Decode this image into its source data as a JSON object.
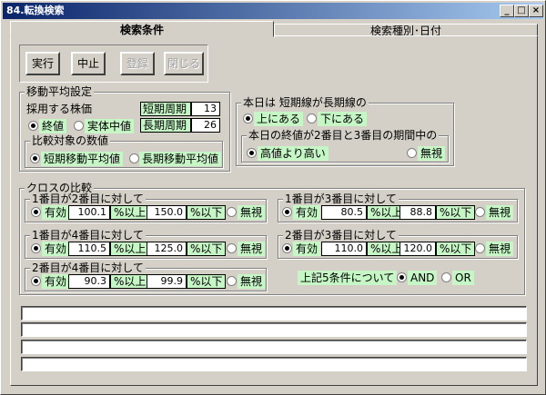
{
  "window": {
    "title": "84.転換検索",
    "min": "_",
    "max": "□",
    "close": "×"
  },
  "tabs": [
    {
      "label": "検索条件"
    },
    {
      "label": "検索種別･日付"
    }
  ],
  "toolbar": {
    "run": "実行",
    "stop": "中止",
    "register": "登録",
    "close": "閉じる"
  },
  "ma": {
    "title": "移動平均設定",
    "price_label": "採用する株価",
    "price_close": "終値",
    "price_body": "実体中値",
    "short_label": "短期周期",
    "short_value": "13",
    "long_label": "長期周期",
    "long_value": "26",
    "cmp_title": "比較対象の数値",
    "cmp_short": "短期移動平均値",
    "cmp_long": "長期移動平均値"
  },
  "today": {
    "title": "本日は 短期線が長期線の",
    "above": "上にある",
    "below": "下にある",
    "sub_title": "本日の終値が2番目と3番目の期間中の",
    "higher": "高値より高い",
    "ignore": "無視"
  },
  "cross": {
    "title": "クロスの比較",
    "valid": "有効",
    "ignore": "無視",
    "ge": "%以上",
    "le": "%以下",
    "g12": {
      "title": "1番目が2番目に対して",
      "low": "100.1",
      "high": "150.0"
    },
    "g13": {
      "title": "1番目が3番目に対して",
      "low": "80.5",
      "high": "88.8"
    },
    "g14": {
      "title": "1番目が4番目に対して",
      "low": "110.5",
      "high": "125.0"
    },
    "g23": {
      "title": "2番目が3番目に対して",
      "low": "110.0",
      "high": "120.0"
    },
    "g24": {
      "title": "2番目が4番目に対して",
      "low": "90.3",
      "high": "99.9"
    },
    "logic_label": "上記5条件について",
    "and": "AND",
    "or": "OR"
  },
  "colors": {
    "highlight": "#c6f6c6",
    "title_bar": "#0a246a",
    "face": "#d4d0c8"
  }
}
